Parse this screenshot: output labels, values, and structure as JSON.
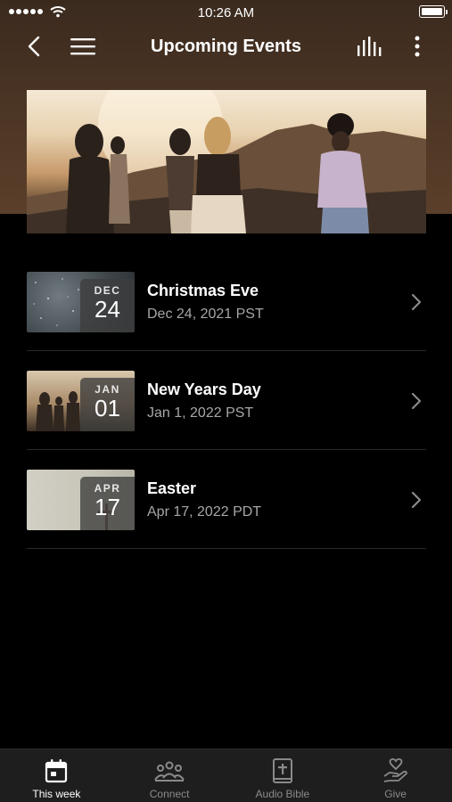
{
  "status_bar": {
    "time": "10:26 AM"
  },
  "nav": {
    "title": "Upcoming Events"
  },
  "events": [
    {
      "month": "DEC",
      "day": "24",
      "title": "Christmas Eve",
      "date": "Dec 24, 2021 PST"
    },
    {
      "month": "JAN",
      "day": "01",
      "title": "New Years Day",
      "date": "Jan 1, 2022 PST"
    },
    {
      "month": "APR",
      "day": "17",
      "title": "Easter",
      "date": "Apr 17, 2022 PDT"
    }
  ],
  "tabs": [
    {
      "label": "This week",
      "icon": "calendar-icon",
      "active": true
    },
    {
      "label": "Connect",
      "icon": "people-icon",
      "active": false
    },
    {
      "label": "Audio Bible",
      "icon": "bible-icon",
      "active": false
    },
    {
      "label": "Give",
      "icon": "give-hand-heart-icon",
      "active": false
    }
  ],
  "colors": {
    "background": "#000000",
    "header_brown": "#4a3424",
    "tab_bar": "#1e1e1e",
    "muted_text": "#a6a6a6"
  }
}
